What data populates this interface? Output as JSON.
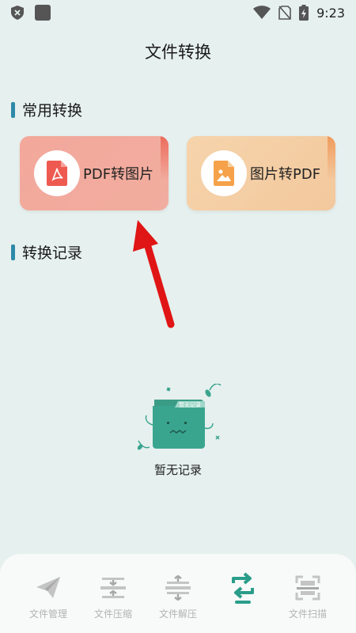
{
  "status_bar": {
    "time": "9:23"
  },
  "header": {
    "title": "文件转换"
  },
  "common_section": {
    "heading": "常用转换",
    "cards": [
      {
        "label": "PDF转图片",
        "icon": "pdf-icon",
        "accent": "#ec6b5b"
      },
      {
        "label": "图片转PDF",
        "icon": "image-icon",
        "accent": "#f09a5c"
      }
    ]
  },
  "records_section": {
    "heading": "转换记录",
    "empty_badge": "暂无记录",
    "empty_text": "暂无记录"
  },
  "bottom_nav": {
    "items": [
      {
        "label": "文件管理",
        "icon": "paper-plane-icon"
      },
      {
        "label": "文件压缩",
        "icon": "compress-icon"
      },
      {
        "label": "文件解压",
        "icon": "decompress-icon"
      },
      {
        "label": "",
        "icon": "convert-icon",
        "active": true
      },
      {
        "label": "文件扫描",
        "icon": "scan-icon"
      }
    ]
  },
  "colors": {
    "background": "#e6f0ee",
    "accent": "#2e8aa8",
    "active_nav": "#2a9d8a",
    "inactive_nav": "#b3b3b3"
  }
}
